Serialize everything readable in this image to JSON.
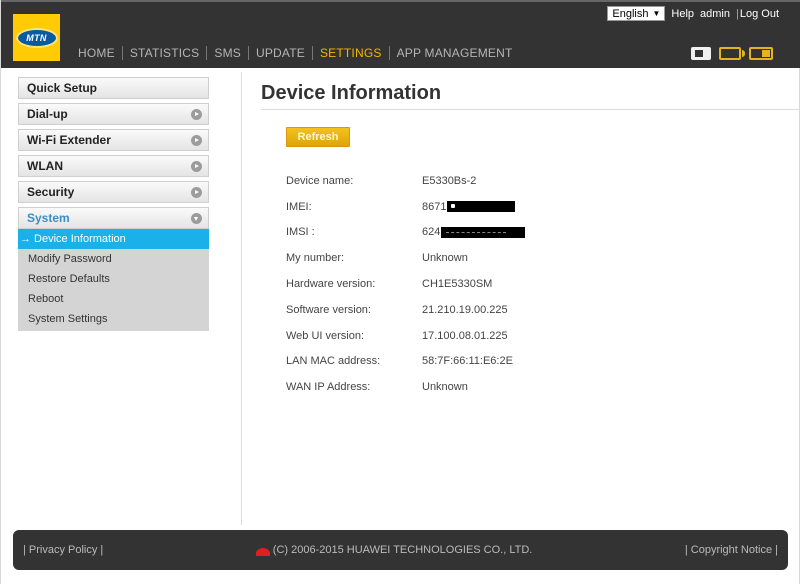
{
  "header": {
    "logo_text": "MTN",
    "language": "English",
    "help_label": "Help",
    "user": "admin",
    "separator": "|",
    "logout_label": "Log Out",
    "nav": [
      {
        "label": "HOME"
      },
      {
        "label": "STATISTICS"
      },
      {
        "label": "SMS"
      },
      {
        "label": "UPDATE"
      },
      {
        "label": "SETTINGS",
        "active": true
      },
      {
        "label": "APP MANAGEMENT"
      }
    ],
    "status_icons": [
      "sim-card-icon",
      "wifi-device-icon",
      "battery-icon"
    ],
    "accent_color": "#f5b400"
  },
  "sidebar": {
    "groups": [
      {
        "label": "Quick Setup"
      },
      {
        "label": "Dial-up"
      },
      {
        "label": "Wi-Fi Extender"
      },
      {
        "label": "WLAN"
      },
      {
        "label": "Security"
      },
      {
        "label": "System",
        "open": true
      }
    ],
    "system_items": [
      {
        "label": "→ Device Information",
        "active": true
      },
      {
        "label": "Modify Password"
      },
      {
        "label": "Restore Defaults"
      },
      {
        "label": "Reboot"
      },
      {
        "label": "System Settings"
      }
    ],
    "active_color": "#1ab1ea"
  },
  "main": {
    "title": "Device Information",
    "refresh_label": "Refresh",
    "rows": [
      {
        "label": "Device name:",
        "value": "E5330Bs-2"
      },
      {
        "label": "IMEI:",
        "value": "8671",
        "redacted": true
      },
      {
        "label": "IMSI :",
        "value": "624",
        "redacted": true
      },
      {
        "label": "My number:",
        "value": "Unknown"
      },
      {
        "label": "Hardware version:",
        "value": "CH1E5330SM"
      },
      {
        "label": "Software version:",
        "value": "21.210.19.00.225"
      },
      {
        "label": "Web UI version:",
        "value": "17.100.08.01.225"
      },
      {
        "label": "LAN MAC address:",
        "value": "58:7F:66:11:E6:2E"
      },
      {
        "label": "WAN IP Address:",
        "value": "Unknown"
      }
    ]
  },
  "footer": {
    "privacy_label": "| Privacy Policy |",
    "copyright": "(C) 2006-2015 HUAWEI TECHNOLOGIES CO., LTD.",
    "copyright_notice_label": "| Copyright Notice |"
  }
}
